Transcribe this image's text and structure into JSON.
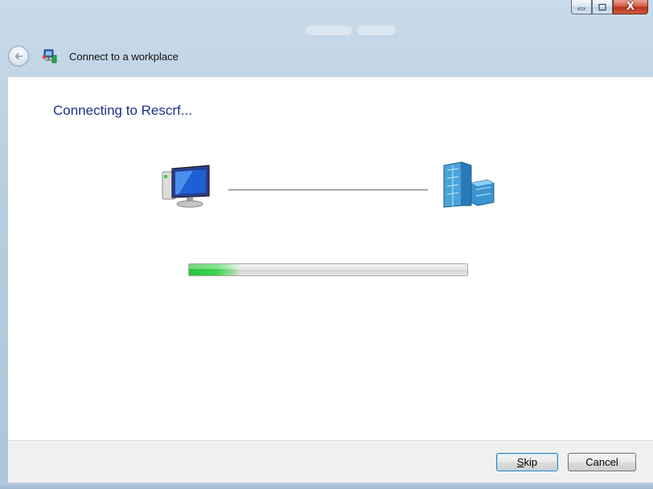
{
  "window": {
    "title": "Connect to a workplace",
    "controls": {
      "minimize": "minimize-icon",
      "maximize": "maximize-icon",
      "close": "close-icon",
      "close_glyph": "X"
    }
  },
  "content": {
    "heading": "Connecting to Rescrf...",
    "diagram": {
      "source_icon": "computer-icon",
      "target_icon": "workplace-building-icon"
    },
    "progress_fraction": 0.18
  },
  "buttons": {
    "skip": {
      "mnemonic": "S",
      "rest": "kip"
    },
    "cancel": "Cancel"
  },
  "colors": {
    "heading": "#1e3287",
    "progress": "#27c23a",
    "close_button": "#c7432b"
  }
}
